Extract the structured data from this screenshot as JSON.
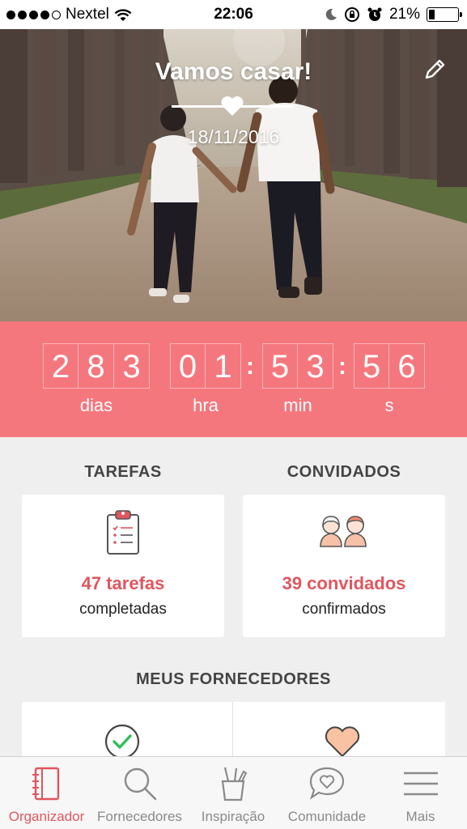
{
  "status_bar": {
    "carrier": "Nextel",
    "time": "22:06",
    "battery": "21%",
    "battery_level": 0.21
  },
  "hero": {
    "title": "Vamos casar!",
    "date": "18/11/2016"
  },
  "countdown": {
    "days": [
      "2",
      "8",
      "3"
    ],
    "hours": [
      "0",
      "1"
    ],
    "minutes": [
      "5",
      "3"
    ],
    "seconds": [
      "5",
      "6"
    ],
    "labels": {
      "days": "dias",
      "hours": "hra",
      "minutes": "min",
      "seconds": "s"
    }
  },
  "tasks": {
    "heading": "TAREFAS",
    "count": "47 tarefas",
    "sub": "completadas"
  },
  "guests": {
    "heading": "CONVIDADOS",
    "count": "39 convidados",
    "sub": "confirmados"
  },
  "vendors": {
    "heading": "MEUS FORNECEDORES"
  },
  "tabbar": {
    "items": [
      {
        "label": "Organizador",
        "icon": "notebook-icon",
        "active": true
      },
      {
        "label": "Fornecedores",
        "icon": "search-icon",
        "active": false
      },
      {
        "label": "Inspiração",
        "icon": "pencil-cup-icon",
        "active": false
      },
      {
        "label": "Comunidade",
        "icon": "chat-heart-icon",
        "active": false
      },
      {
        "label": "Mais",
        "icon": "menu-icon",
        "active": false
      }
    ]
  },
  "colors": {
    "accent": "#f5777e",
    "accent_text": "#e0565e"
  }
}
